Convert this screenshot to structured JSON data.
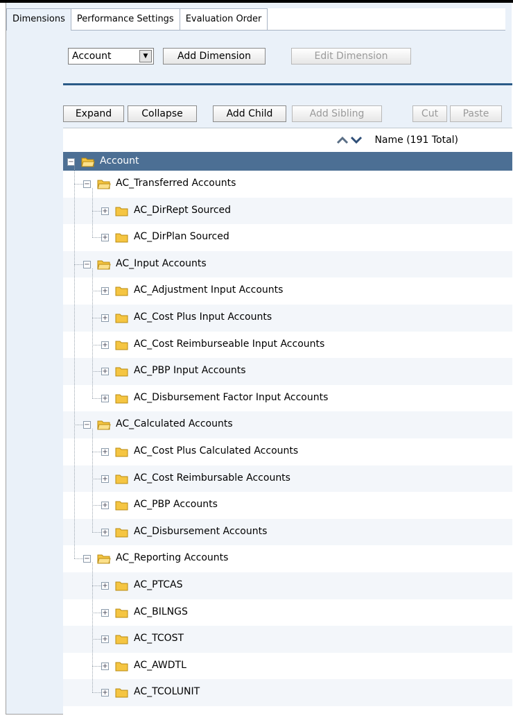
{
  "tabs": [
    {
      "label": "Dimensions"
    },
    {
      "label": "Performance Settings"
    },
    {
      "label": "Evaluation Order"
    }
  ],
  "dimension_select": {
    "value": "Account"
  },
  "dimension_toolbar": {
    "add_label": "Add Dimension",
    "edit_label": "Edit Dimension"
  },
  "tree_toolbar": {
    "expand": "Expand",
    "collapse": "Collapse",
    "add_child": "Add Child",
    "add_sibling": "Add Sibling",
    "cut": "Cut",
    "paste": "Paste"
  },
  "tree_header": {
    "label": "Name  (191 Total)"
  },
  "tree": [
    {
      "label": "Account",
      "level": 0,
      "toggle": "minus",
      "icon": "open-folder",
      "selected": true
    },
    {
      "label": "AC_Transferred Accounts",
      "level": 1,
      "toggle": "minus",
      "icon": "open-folder"
    },
    {
      "label": "AC_DirRept Sourced",
      "level": 2,
      "toggle": "plus",
      "icon": "folder"
    },
    {
      "label": "AC_DirPlan Sourced",
      "level": 2,
      "toggle": "plus",
      "icon": "folder",
      "last": true
    },
    {
      "label": "AC_Input Accounts",
      "level": 1,
      "toggle": "minus",
      "icon": "open-folder"
    },
    {
      "label": "AC_Adjustment Input Accounts",
      "level": 2,
      "toggle": "plus",
      "icon": "folder"
    },
    {
      "label": "AC_Cost Plus Input Accounts",
      "level": 2,
      "toggle": "plus",
      "icon": "folder"
    },
    {
      "label": "AC_Cost Reimburseable Input Accounts",
      "level": 2,
      "toggle": "plus",
      "icon": "folder"
    },
    {
      "label": "AC_PBP Input Accounts",
      "level": 2,
      "toggle": "plus",
      "icon": "folder"
    },
    {
      "label": "AC_Disbursement Factor Input Accounts",
      "level": 2,
      "toggle": "plus",
      "icon": "folder",
      "last": true
    },
    {
      "label": "AC_Calculated Accounts",
      "level": 1,
      "toggle": "minus",
      "icon": "open-folder"
    },
    {
      "label": "AC_Cost Plus Calculated Accounts",
      "level": 2,
      "toggle": "plus",
      "icon": "folder"
    },
    {
      "label": "AC_Cost Reimbursable Accounts",
      "level": 2,
      "toggle": "plus",
      "icon": "folder"
    },
    {
      "label": "AC_PBP Accounts",
      "level": 2,
      "toggle": "plus",
      "icon": "folder"
    },
    {
      "label": "AC_Disbursement Accounts",
      "level": 2,
      "toggle": "plus",
      "icon": "folder",
      "last": true
    },
    {
      "label": "AC_Reporting Accounts",
      "level": 1,
      "toggle": "minus",
      "icon": "open-folder",
      "last": true
    },
    {
      "label": "AC_PTCAS",
      "level": 2,
      "toggle": "plus",
      "icon": "folder"
    },
    {
      "label": "AC_BILNGS",
      "level": 2,
      "toggle": "plus",
      "icon": "folder"
    },
    {
      "label": "AC_TCOST",
      "level": 2,
      "toggle": "plus",
      "icon": "folder"
    },
    {
      "label": "AC_AWDTL",
      "level": 2,
      "toggle": "plus",
      "icon": "folder"
    },
    {
      "label": "AC_TCOLUNIT",
      "level": 2,
      "toggle": "plus",
      "icon": "folder",
      "last": true
    }
  ],
  "colors": {
    "selected_row": "#4c6f94",
    "accent_rule": "#2a5a87",
    "folder": "#f5c542"
  }
}
